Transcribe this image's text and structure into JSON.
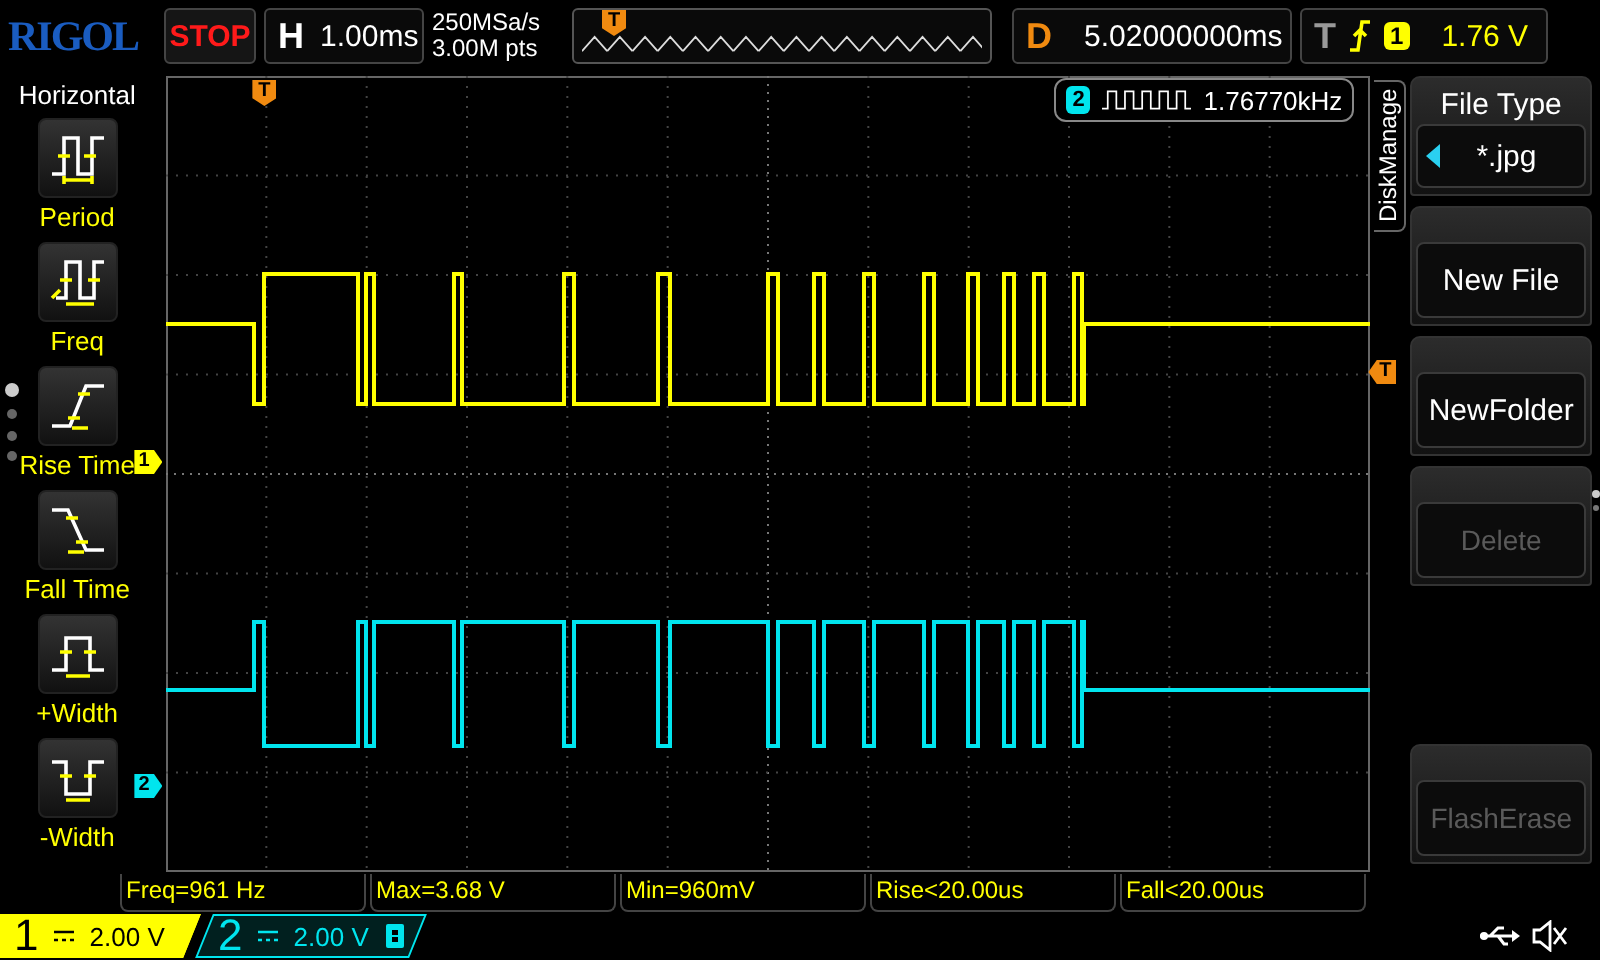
{
  "top_bar": {
    "brand": "RIGOL",
    "run_state": "STOP",
    "timebase": {
      "label": "H",
      "value": "1.00ms"
    },
    "sample_rate": "250MSa/s",
    "memory_depth": "3.00M pts",
    "overview_marker": "T",
    "delay": {
      "label": "D",
      "value": "5.02000000ms"
    },
    "trigger": {
      "label": "T",
      "source": "1",
      "level": "1.76 V"
    }
  },
  "left_menu": {
    "title": "Horizontal",
    "items": [
      {
        "label": "Period",
        "kind": "period"
      },
      {
        "label": "Freq",
        "kind": "freq"
      },
      {
        "label": "Rise Time",
        "kind": "rise"
      },
      {
        "label": "Fall Time",
        "kind": "fall"
      },
      {
        "label": "+Width",
        "kind": "pwidth"
      },
      {
        "label": "-Width",
        "kind": "nwidth"
      }
    ]
  },
  "plot": {
    "trigger_marker_top": "T",
    "trigger_marker_right": "T",
    "channel_markers": [
      {
        "label": "1"
      },
      {
        "label": "2"
      }
    ],
    "counter": {
      "channel": "2",
      "value": "1.76770kHz"
    }
  },
  "right_menu": {
    "tab": "DiskManage",
    "items": [
      {
        "kind": "select",
        "title": "File Type",
        "value": "*.jpg"
      },
      {
        "kind": "button",
        "label": "New File",
        "disabled": false
      },
      {
        "kind": "button",
        "label": "NewFolder",
        "disabled": false
      },
      {
        "kind": "button",
        "label": "Delete",
        "disabled": true
      },
      {
        "kind": "button",
        "label": "FlashErase",
        "disabled": true
      }
    ]
  },
  "measurements": [
    "Freq=961 Hz",
    "Max=3.68 V",
    "Min=960mV",
    "Rise<20.00us",
    "Fall<20.00us"
  ],
  "channels": [
    {
      "number": "1",
      "scale": "2.00 V",
      "color": "#ffff00",
      "selected": true,
      "bandwidth_limit": false
    },
    {
      "number": "2",
      "scale": "2.00 V",
      "color": "#00e5ee",
      "selected": false,
      "bandwidth_limit": true
    }
  ]
}
